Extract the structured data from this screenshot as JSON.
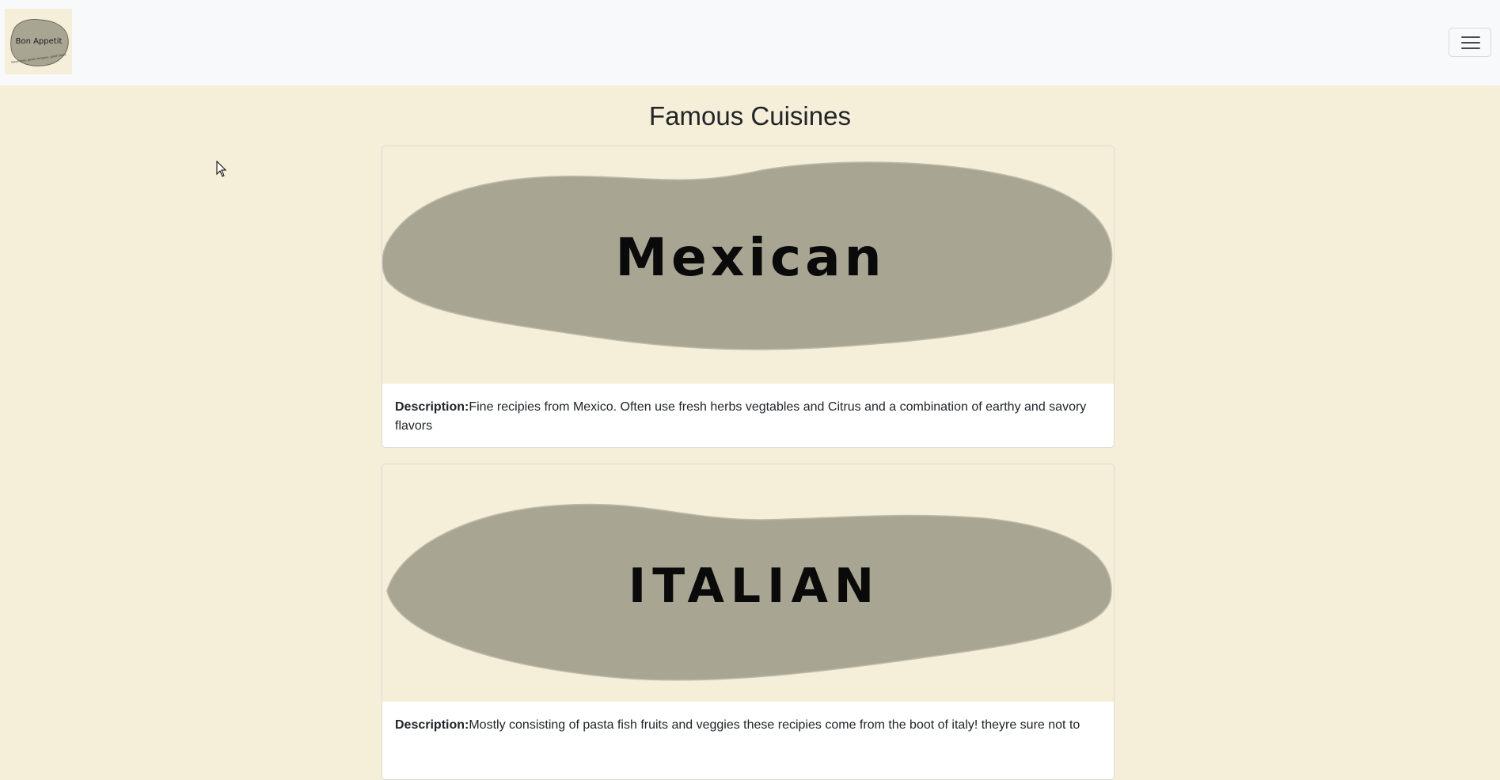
{
  "navbar": {
    "logo_title": "Bon Appetit",
    "logo_subtitle": "Good food, good company, good times",
    "menu_toggle_icon": "hamburger-icon"
  },
  "page": {
    "title": "Famous Cuisines"
  },
  "cuisines": [
    {
      "image_label": "Mexican",
      "description_label": "Description:",
      "description_text": "Fine recipies from Mexico. Often use fresh herbs vegtables and Citrus and a combination of earthy and savory flavors"
    },
    {
      "image_label": "ITALIAN",
      "description_label": "Description:",
      "description_text": "Mostly consisting of pasta fish fruits and veggies these recipies come from the boot of italy! theyre sure not to"
    }
  ],
  "colors": {
    "page_background": "#f5eed8",
    "navbar_background": "#f8f9fa",
    "blob": "#a8a593"
  }
}
